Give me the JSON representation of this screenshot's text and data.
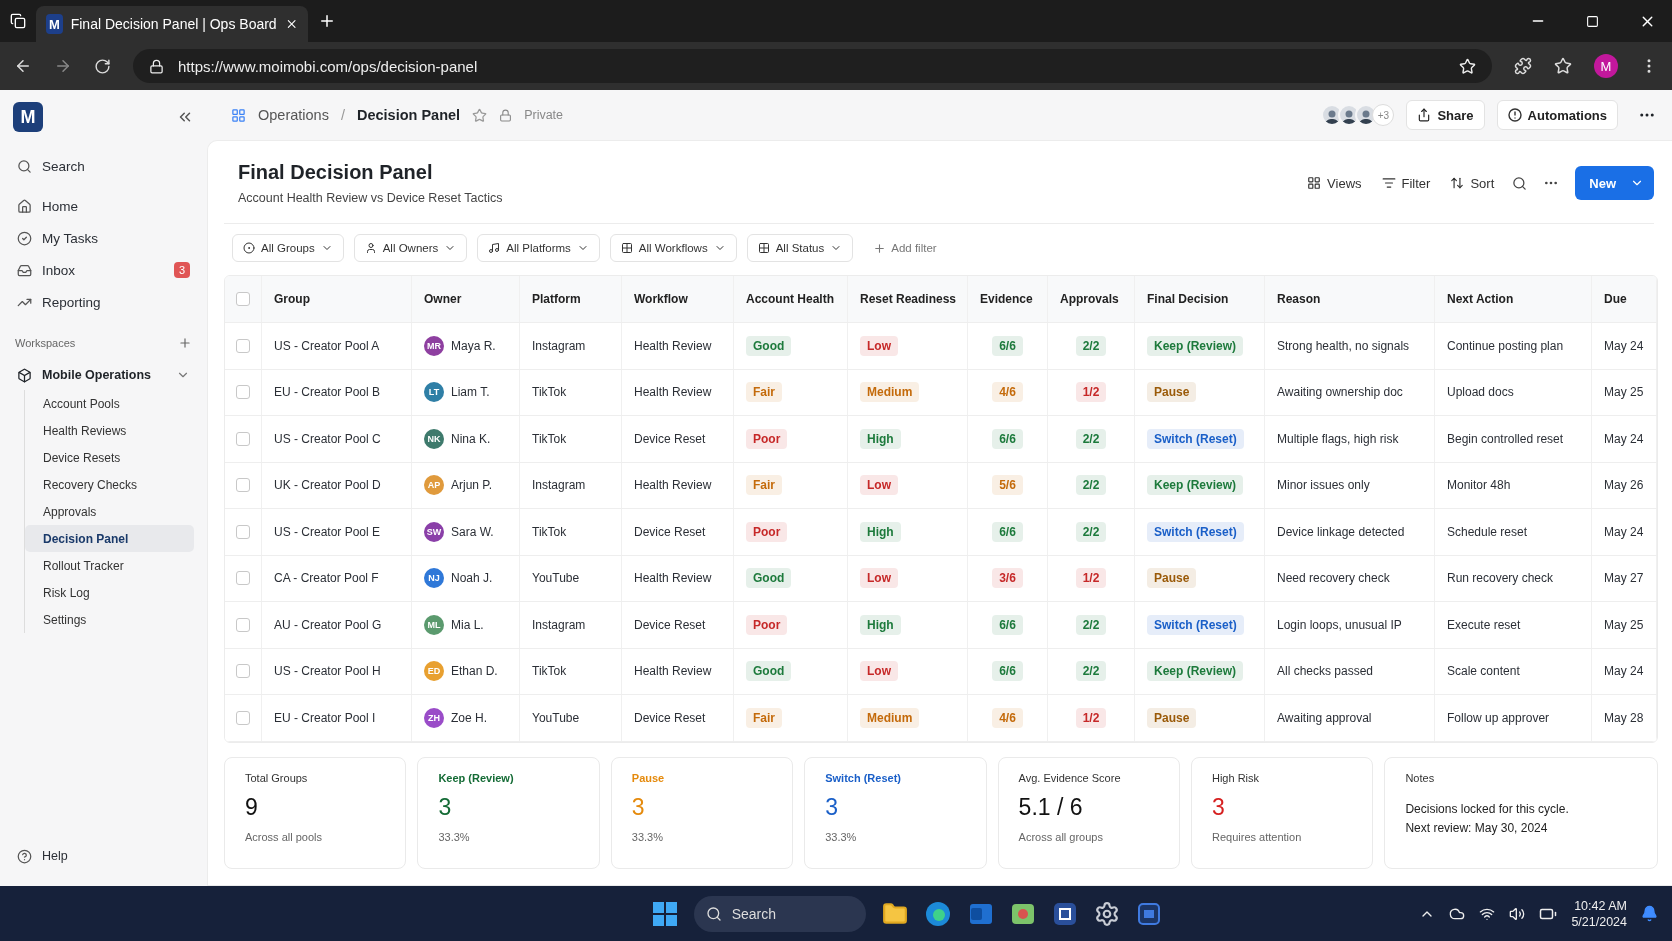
{
  "browser": {
    "tab_title": "Final Decision Panel | Ops Board",
    "tab_logo": "M",
    "url": "https://www.moimobi.com/ops/decision-panel",
    "profile_initial": "M"
  },
  "sidebar": {
    "logo": "M",
    "nav": [
      {
        "kind": "search",
        "label": "Search"
      },
      {
        "kind": "home",
        "label": "Home"
      },
      {
        "kind": "tasks",
        "label": "My Tasks"
      },
      {
        "kind": "inbox",
        "label": "Inbox",
        "badge": "3"
      },
      {
        "kind": "reporting",
        "label": "Reporting"
      }
    ],
    "workspaces_label": "Workspaces",
    "workspace": {
      "label": "Mobile Operations",
      "expanded": true,
      "children": [
        {
          "label": "Account Pools",
          "selected": false
        },
        {
          "label": "Health Reviews",
          "selected": false
        },
        {
          "label": "Device Resets",
          "selected": false
        },
        {
          "label": "Recovery Checks",
          "selected": false
        },
        {
          "label": "Approvals",
          "selected": false
        },
        {
          "label": "Decision Panel",
          "selected": true
        },
        {
          "label": "Rollout Tracker",
          "selected": false
        },
        {
          "label": "Risk Log",
          "selected": false
        },
        {
          "label": "Settings",
          "selected": false
        }
      ]
    },
    "help": "Help"
  },
  "header": {
    "breadcrumb": [
      "Operations",
      "Decision Panel"
    ],
    "breadcrumb_separator": "/",
    "visibility": "Private",
    "collaborators_more": "+3",
    "share": "Share",
    "automations": "Automations"
  },
  "page": {
    "title": "Final Decision Panel",
    "subtitle": "Account Health Review vs Device Reset Tactics",
    "toolbar": [
      {
        "kind": "views",
        "label": "Views"
      },
      {
        "kind": "filter",
        "label": "Filter"
      },
      {
        "kind": "sort",
        "label": "Sort"
      }
    ],
    "new_button": "New",
    "filters": [
      {
        "kind": "groups",
        "label": "All Groups"
      },
      {
        "kind": "owners",
        "label": "All Owners"
      },
      {
        "kind": "platforms",
        "label": "All Platforms"
      },
      {
        "kind": "workflows",
        "label": "All Workflows"
      },
      {
        "kind": "status",
        "label": "All Status"
      }
    ],
    "add_filter": "Add filter"
  },
  "table": {
    "header_checked": false,
    "columns": [
      "Group",
      "Owner",
      "Platform",
      "Workflow",
      "Account Health",
      "Reset Readiness",
      "Evidence",
      "Approvals",
      "Final Decision",
      "Reason",
      "Next Action",
      "Due"
    ],
    "rows": [
      {
        "checked": false,
        "group": "US - Creator Pool A",
        "owner": {
          "initials": "MR",
          "name": "Maya R.",
          "color": "#8e3fa0"
        },
        "platform": "Instagram",
        "workflow": "Health Review",
        "health": {
          "text": "Good",
          "color": "#1d7a3c"
        },
        "readiness": {
          "text": "Low",
          "color": "#c62828"
        },
        "evidence": {
          "text": "6/6",
          "color": "#1d7a3c"
        },
        "approvals": {
          "text": "2/2",
          "color": "#1d7a3c"
        },
        "decision": {
          "text": "Keep (Review)",
          "color": "#1d7a3c"
        },
        "reason": "Strong health, no signals",
        "next_action": "Continue posting plan",
        "due": "May 24"
      },
      {
        "checked": false,
        "group": "EU - Creator Pool B",
        "owner": {
          "initials": "LT",
          "name": "Liam T.",
          "color": "#2f7fa6"
        },
        "platform": "TikTok",
        "workflow": "Health Review",
        "health": {
          "text": "Fair",
          "color": "#c46a0a"
        },
        "readiness": {
          "text": "Medium",
          "color": "#c46a0a"
        },
        "evidence": {
          "text": "4/6",
          "color": "#c46a0a"
        },
        "approvals": {
          "text": "1/2",
          "color": "#c62828"
        },
        "decision": {
          "text": "Pause",
          "color": "#9a5a08"
        },
        "reason": "Awaiting ownership doc",
        "next_action": "Upload docs",
        "due": "May 25"
      },
      {
        "checked": false,
        "group": "US - Creator Pool C",
        "owner": {
          "initials": "NK",
          "name": "Nina K.",
          "color": "#3e7a6c"
        },
        "platform": "TikTok",
        "workflow": "Device Reset",
        "health": {
          "text": "Poor",
          "color": "#c62828"
        },
        "readiness": {
          "text": "High",
          "color": "#1d7a3c"
        },
        "evidence": {
          "text": "6/6",
          "color": "#1d7a3c"
        },
        "approvals": {
          "text": "2/2",
          "color": "#1d7a3c"
        },
        "decision": {
          "text": "Switch (Reset)",
          "color": "#1a5fc8"
        },
        "reason": "Multiple flags, high risk",
        "next_action": "Begin controlled reset",
        "due": "May 24"
      },
      {
        "checked": false,
        "group": "UK - Creator Pool D",
        "owner": {
          "initials": "AP",
          "name": "Arjun P.",
          "color": "#e09a3c"
        },
        "platform": "Instagram",
        "workflow": "Health Review",
        "health": {
          "text": "Fair",
          "color": "#c46a0a"
        },
        "readiness": {
          "text": "Low",
          "color": "#c62828"
        },
        "evidence": {
          "text": "5/6",
          "color": "#c46a0a"
        },
        "approvals": {
          "text": "2/2",
          "color": "#1d7a3c"
        },
        "decision": {
          "text": "Keep (Review)",
          "color": "#1d7a3c"
        },
        "reason": "Minor issues only",
        "next_action": "Monitor 48h",
        "due": "May 26"
      },
      {
        "checked": false,
        "group": "US - Creator Pool E",
        "owner": {
          "initials": "SW",
          "name": "Sara W.",
          "color": "#8a3fa8"
        },
        "platform": "TikTok",
        "workflow": "Device Reset",
        "health": {
          "text": "Poor",
          "color": "#c62828"
        },
        "readiness": {
          "text": "High",
          "color": "#1d7a3c"
        },
        "evidence": {
          "text": "6/6",
          "color": "#1d7a3c"
        },
        "approvals": {
          "text": "2/2",
          "color": "#1d7a3c"
        },
        "decision": {
          "text": "Switch (Reset)",
          "color": "#1a5fc8"
        },
        "reason": "Device linkage detected",
        "next_action": "Schedule reset",
        "due": "May 24"
      },
      {
        "checked": false,
        "group": "CA - Creator Pool F",
        "owner": {
          "initials": "NJ",
          "name": "Noah J.",
          "color": "#2f78d8"
        },
        "platform": "YouTube",
        "workflow": "Health Review",
        "health": {
          "text": "Good",
          "color": "#1d7a3c"
        },
        "readiness": {
          "text": "Low",
          "color": "#c62828"
        },
        "evidence": {
          "text": "3/6",
          "color": "#c62828"
        },
        "approvals": {
          "text": "1/2",
          "color": "#c62828"
        },
        "decision": {
          "text": "Pause",
          "color": "#9a5a08"
        },
        "reason": "Need recovery check",
        "next_action": "Run recovery check",
        "due": "May 27"
      },
      {
        "checked": false,
        "group": "AU - Creator Pool G",
        "owner": {
          "initials": "ML",
          "name": "Mia L.",
          "color": "#5b9a6e"
        },
        "platform": "Instagram",
        "workflow": "Device Reset",
        "health": {
          "text": "Poor",
          "color": "#c62828"
        },
        "readiness": {
          "text": "High",
          "color": "#1d7a3c"
        },
        "evidence": {
          "text": "6/6",
          "color": "#1d7a3c"
        },
        "approvals": {
          "text": "2/2",
          "color": "#1d7a3c"
        },
        "decision": {
          "text": "Switch (Reset)",
          "color": "#1a5fc8"
        },
        "reason": "Login loops, unusual IP",
        "next_action": "Execute reset",
        "due": "May 25"
      },
      {
        "checked": false,
        "group": "US - Creator Pool H",
        "owner": {
          "initials": "ED",
          "name": "Ethan D.",
          "color": "#e8a030"
        },
        "platform": "TikTok",
        "workflow": "Health Review",
        "health": {
          "text": "Good",
          "color": "#1d7a3c"
        },
        "readiness": {
          "text": "Low",
          "color": "#c62828"
        },
        "evidence": {
          "text": "6/6",
          "color": "#1d7a3c"
        },
        "approvals": {
          "text": "2/2",
          "color": "#1d7a3c"
        },
        "decision": {
          "text": "Keep (Review)",
          "color": "#1d7a3c"
        },
        "reason": "All checks passed",
        "next_action": "Scale content",
        "due": "May 24"
      },
      {
        "checked": false,
        "group": "EU - Creator Pool I",
        "owner": {
          "initials": "ZH",
          "name": "Zoe H.",
          "color": "#9a4cc8"
        },
        "platform": "YouTube",
        "workflow": "Device Reset",
        "health": {
          "text": "Fair",
          "color": "#c46a0a"
        },
        "readiness": {
          "text": "Medium",
          "color": "#c46a0a"
        },
        "evidence": {
          "text": "4/6",
          "color": "#c46a0a"
        },
        "approvals": {
          "text": "1/2",
          "color": "#c62828"
        },
        "decision": {
          "text": "Pause",
          "color": "#9a5a08"
        },
        "reason": "Awaiting approval",
        "next_action": "Follow up approver",
        "due": "May 28"
      }
    ]
  },
  "summary": [
    {
      "kind": "stat",
      "label": "Total Groups",
      "value": "9",
      "sub": "Across all pools",
      "color": "#111111"
    },
    {
      "kind": "accent",
      "label": "Keep (Review)",
      "value": "3",
      "sub": "33.3%",
      "color": "#146b35"
    },
    {
      "kind": "accent",
      "label": "Pause",
      "value": "3",
      "sub": "33.3%",
      "color": "#e58a0c"
    },
    {
      "kind": "accent",
      "label": "Switch (Reset)",
      "value": "3",
      "sub": "33.3%",
      "color": "#1a5fc8"
    },
    {
      "kind": "stat",
      "label": "Avg. Evidence Score",
      "value": "5.1 / 6",
      "sub": "Across all groups",
      "color": "#111111"
    },
    {
      "kind": "stat",
      "label": "High Risk",
      "value": "3",
      "sub": "Requires attention",
      "color": "#d61f1f"
    },
    {
      "kind": "notes",
      "label": "Notes",
      "lines": [
        "Decisions locked for this cycle.",
        "Next review: May 30, 2024"
      ]
    }
  ],
  "taskbar": {
    "search": "Search",
    "time": "10:42 AM",
    "date": "5/21/2024"
  }
}
